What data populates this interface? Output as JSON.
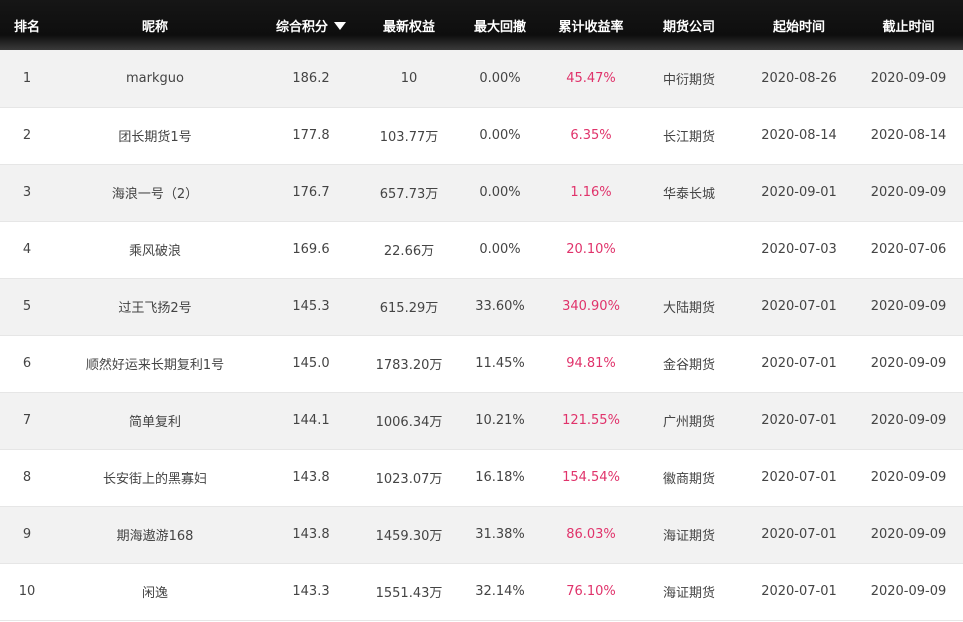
{
  "colors": {
    "header_bg": "#111111",
    "header_text": "#ffffff",
    "row_odd": "#f2f2f2",
    "row_even": "#ffffff",
    "rate_color": "#e0336b",
    "text": "#444444"
  },
  "icons": {
    "sort": "triangle-down-icon"
  },
  "table": {
    "headers": [
      "排名",
      "昵称",
      "综合积分",
      "最新权益",
      "最大回撤",
      "累计收益率",
      "期货公司",
      "起始时间",
      "截止时间"
    ],
    "rows": [
      [
        "1",
        "markguo",
        "186.2",
        "10",
        "0.00%",
        "45.47%",
        "中衍期货",
        "2020-08-26",
        "2020-09-09"
      ],
      [
        "2",
        "团长期货1号",
        "177.8",
        "103.77万",
        "0.00%",
        "6.35%",
        "长江期货",
        "2020-08-14",
        "2020-08-14"
      ],
      [
        "3",
        "海浪一号（2）",
        "176.7",
        "657.73万",
        "0.00%",
        "1.16%",
        "华泰长城",
        "2020-09-01",
        "2020-09-09"
      ],
      [
        "4",
        "乘风破浪",
        "169.6",
        "22.66万",
        "0.00%",
        "20.10%",
        "",
        "2020-07-03",
        "2020-07-06"
      ],
      [
        "5",
        "过王飞扬2号",
        "145.3",
        "615.29万",
        "33.60%",
        "340.90%",
        "大陆期货",
        "2020-07-01",
        "2020-09-09"
      ],
      [
        "6",
        "顺然好运来长期复利1号",
        "145.0",
        "1783.20万",
        "11.45%",
        "94.81%",
        "金谷期货",
        "2020-07-01",
        "2020-09-09"
      ],
      [
        "7",
        "简单复利",
        "144.1",
        "1006.34万",
        "10.21%",
        "121.55%",
        "广州期货",
        "2020-07-01",
        "2020-09-09"
      ],
      [
        "8",
        "长安街上的黑寡妇",
        "143.8",
        "1023.07万",
        "16.18%",
        "154.54%",
        "徽商期货",
        "2020-07-01",
        "2020-09-09"
      ],
      [
        "9",
        "期海遨游168",
        "143.8",
        "1459.30万",
        "31.38%",
        "86.03%",
        "海证期货",
        "2020-07-01",
        "2020-09-09"
      ],
      [
        "10",
        "闲逸",
        "143.3",
        "1551.43万",
        "32.14%",
        "76.10%",
        "海证期货",
        "2020-07-01",
        "2020-09-09"
      ]
    ]
  }
}
